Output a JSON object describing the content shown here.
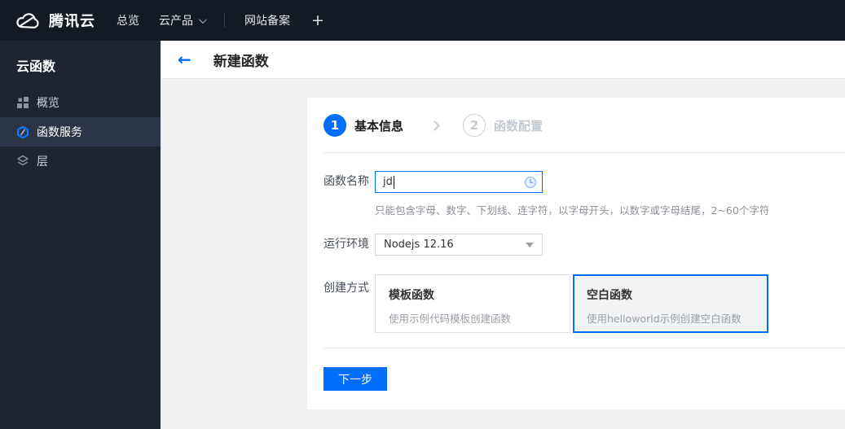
{
  "topbar": {
    "brand": "腾讯云",
    "nav_overview": "总览",
    "nav_cloud_products": "云产品",
    "nav_website_icp": "网站备案",
    "plus": "+"
  },
  "sidebar": {
    "title": "云函数",
    "items": [
      {
        "label": "概览",
        "icon": "grid-icon",
        "active": false
      },
      {
        "label": "函数服务",
        "icon": "function-hexagon-icon",
        "active": true
      },
      {
        "label": "层",
        "icon": "layers-icon",
        "active": false
      }
    ]
  },
  "header": {
    "back": "←",
    "title": "新建函数"
  },
  "steps": [
    {
      "number": "1",
      "label": "基本信息",
      "active": true
    },
    {
      "number": "2",
      "label": "函数配置",
      "active": false
    }
  ],
  "form": {
    "name": {
      "label": "函数名称",
      "value": "jd",
      "help": "只能包含字母、数字、下划线、连字符，以字母开头，以数字或字母结尾，2~60个字符"
    },
    "runtime": {
      "label": "运行环境",
      "value": "Nodejs 12.16"
    },
    "method": {
      "label": "创建方式",
      "options": [
        {
          "title": "模板函数",
          "desc": "使用示例代码模板创建函数",
          "selected": false
        },
        {
          "title": "空白函数",
          "desc": "使用helloworld示例创建空白函数",
          "selected": true
        }
      ]
    }
  },
  "footer": {
    "next_label": "下一步"
  },
  "colors": {
    "primary": "#006eff",
    "topbar_bg": "#141a24",
    "sidebar_bg": "#1e2430",
    "sidebar_active_bg": "#2c3545",
    "page_bg": "#f0f1f3",
    "selected_card_bg": "#f2f3f5"
  }
}
